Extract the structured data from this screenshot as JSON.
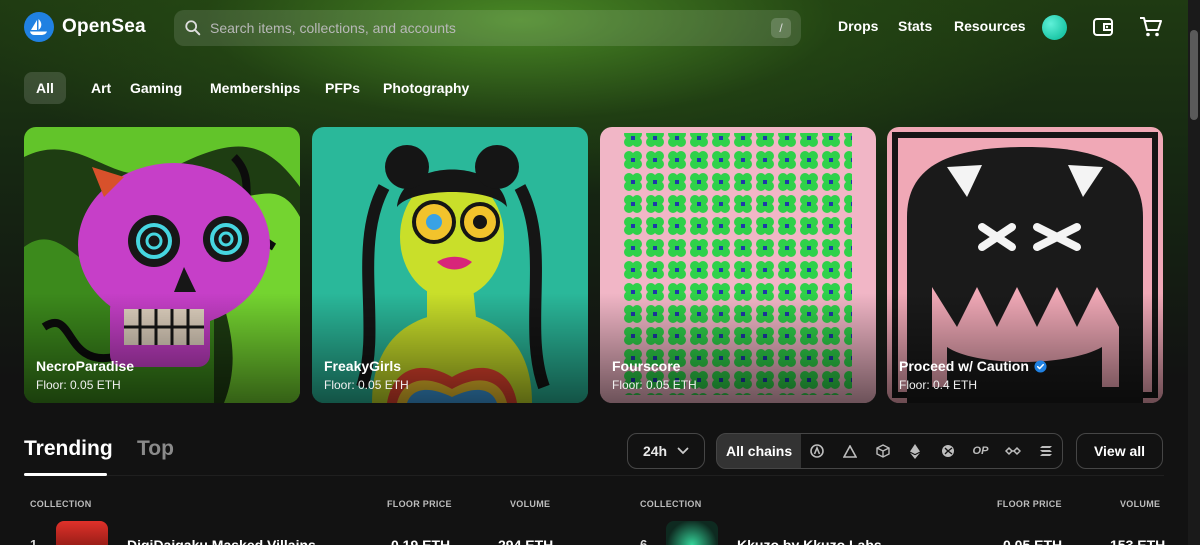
{
  "brand": {
    "name": "OpenSea",
    "logo_icon": "sailboat-logo-icon"
  },
  "search": {
    "placeholder": "Search items, collections, and accounts",
    "shortcut": "/"
  },
  "nav": {
    "drops": "Drops",
    "stats": "Stats",
    "resources": "Resources"
  },
  "header_icons": [
    "avatar",
    "wallet-icon",
    "cart-icon"
  ],
  "categories": [
    "All",
    "Art",
    "Gaming",
    "Memberships",
    "PFPs",
    "Photography"
  ],
  "active_category": "All",
  "featured": [
    {
      "name": "NecroParadise",
      "floor": "Floor: 0.05 ETH",
      "verified": false
    },
    {
      "name": "FreakyGirls",
      "floor": "Floor: 0.05 ETH",
      "verified": false
    },
    {
      "name": "Fourscore",
      "floor": "Floor: 0.05 ETH",
      "verified": false
    },
    {
      "name": "Proceed w/ Caution",
      "floor": "Floor: 0.4 ETH",
      "verified": true
    }
  ],
  "ranking": {
    "tabs": [
      "Trending",
      "Top"
    ],
    "active_tab": "Trending",
    "time_range": "24h",
    "chains_label": "All chains",
    "chain_icons": [
      "arbitrum-icon",
      "avalanche-icon",
      "base-icon",
      "ethereum-icon",
      "klaytn-icon",
      "optimism-icon",
      "polygon-icon",
      "solana-icon"
    ],
    "optimism_text": "OP",
    "view_all": "View all",
    "columns": {
      "collection": "COLLECTION",
      "floor_price": "FLOOR PRICE",
      "volume": "VOLUME"
    }
  },
  "table_rows": [
    {
      "rank": "1",
      "name": "DigiDaigaku Masked Villains",
      "floor": "0.19 ETH",
      "volume": "294 ETH"
    },
    {
      "rank": "6",
      "name": "Kkuzo by Kkuzo Labs",
      "floor": "0.05 ETH",
      "volume": "153 ETH"
    }
  ],
  "colors": {
    "brand_blue": "#2081e2",
    "verified_blue": "#2081e2",
    "background": "#121212"
  }
}
